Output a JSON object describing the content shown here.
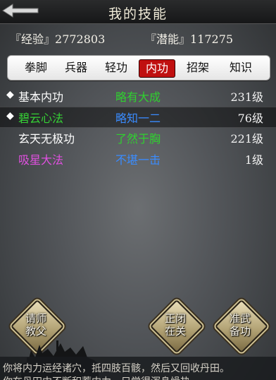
{
  "header": {
    "title": "我的技能",
    "back_icon": "back-arrow-icon"
  },
  "stats": {
    "exp_label": "『经验』",
    "exp_value": "2772803",
    "potential_label": "『潜能』",
    "potential_value": "117275"
  },
  "tabs": [
    {
      "label": "拳脚",
      "active": false
    },
    {
      "label": "兵器",
      "active": false
    },
    {
      "label": "轻功",
      "active": false
    },
    {
      "label": "内功",
      "active": true
    },
    {
      "label": "招架",
      "active": false
    },
    {
      "label": "知识",
      "active": false
    }
  ],
  "skills": [
    {
      "marker": "◆",
      "name": "基本内功",
      "name_color": "#ffffff",
      "grade": "略有大成",
      "grade_color": "#2fd12f",
      "level": "231级"
    },
    {
      "marker": "◆",
      "name": "碧云心法",
      "name_color": "#36d136",
      "grade": "略知一二",
      "grade_color": "#3a8cff",
      "level": "76级"
    },
    {
      "marker": "",
      "name": "玄天无极功",
      "name_color": "#ffffff",
      "grade": "了然于胸",
      "grade_color": "#2fd12f",
      "level": "221级"
    },
    {
      "marker": "",
      "name": "吸星大法",
      "name_color": "#e050e0",
      "grade": "不堪一击",
      "grade_color": "#3a8cff",
      "level": "1级"
    }
  ],
  "buttons": {
    "teacher": [
      "请师",
      "教父"
    ],
    "close": [
      "正闭",
      "在关"
    ],
    "prepare": [
      "准武",
      "备功"
    ]
  },
  "messages": [
    "你将内力运经诸穴，抵四肢百骸，然后又回收丹田。",
    "你在丹田中不断积蓄内力，只觉得浑身燥热"
  ]
}
